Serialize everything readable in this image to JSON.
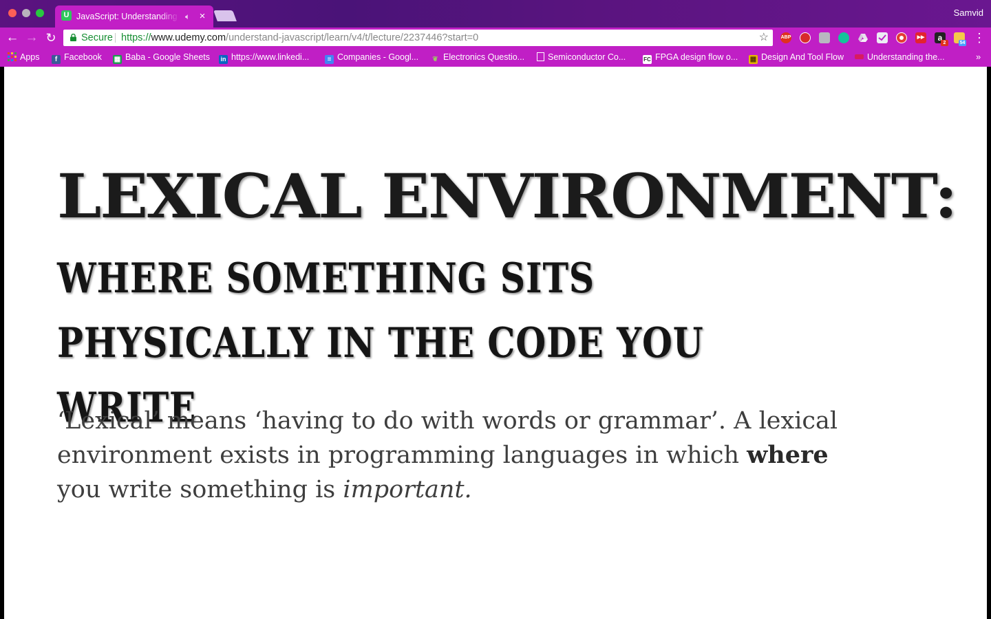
{
  "window": {
    "profile_name": "Samvid"
  },
  "tab": {
    "favicon_letter": "U",
    "title": "JavaScript: Understanding the Weird Parts | Udemy",
    "close_glyph": "×"
  },
  "toolbar": {
    "secure_label": "Secure",
    "url_scheme": "https://",
    "url_host": "www.udemy.com",
    "url_path": "/understand-javascript/learn/v4/t/lecture/2237446?start=0",
    "extension_labels": {
      "abp": "ABP",
      "amazon": "a",
      "amazon_badge": "2",
      "calendar_badge": "54"
    }
  },
  "bookmarks": [
    {
      "label": "Apps",
      "icon": "apps-grid-icon",
      "color": "#e64a19"
    },
    {
      "label": "Facebook",
      "icon": "facebook-icon",
      "color": "#3b5998"
    },
    {
      "label": "Baba - Google Sheets",
      "icon": "sheets-icon",
      "color": "#1e9e4f"
    },
    {
      "label": "https://www.linkedi...",
      "icon": "linkedin-icon",
      "color": "#0a66c2"
    },
    {
      "label": "Companies - Googl...",
      "icon": "docs-icon",
      "color": "#4285f4"
    },
    {
      "label": "Electronics Questio...",
      "icon": "leaf-icon",
      "color": "#7cb342"
    },
    {
      "label": "Semiconductor Co...",
      "icon": "page-icon",
      "color": "#ffffff"
    },
    {
      "label": "FPGA design flow o...",
      "icon": "fc-icon",
      "color": "#ffffff"
    },
    {
      "label": "Design And Tool Flow",
      "icon": "design-icon",
      "color": "#e6b800"
    },
    {
      "label": "Understanding the...",
      "icon": "site-icon",
      "color": "#d81b60"
    }
  ],
  "bookmark_more": "»",
  "slide": {
    "title": "LEXICAL ENVIRONMENT:",
    "subtitle": "WHERE SOMETHING SITS PHYSICALLY IN THE CODE YOU WRITE",
    "body_part1": "‘Lexical’ means ‘having to do with words or grammar’. A lexical environment exists in programming languages in which ",
    "body_strong": "where",
    "body_part2": " you write something is ",
    "body_em": "important",
    "body_end": "."
  },
  "colors": {
    "browser_accent": "#c01fc5",
    "titlebar": "#4a1378",
    "secure_green": "#178e33"
  }
}
